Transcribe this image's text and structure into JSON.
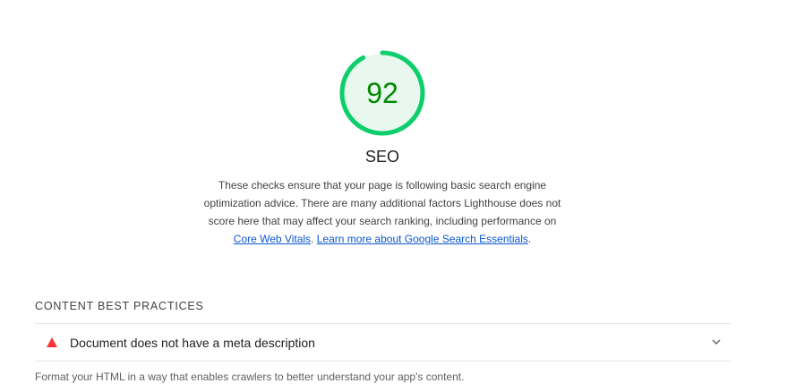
{
  "score": {
    "value": "92",
    "fraction": 0.92,
    "color": "#0cce6b",
    "text_color": "#008800",
    "fill_color": "#e8f8ee"
  },
  "category": {
    "title": "SEO",
    "description_text": "These checks ensure that your page is following basic search engine optimization advice. There are many additional factors Lighthouse does not score here that may affect your search ranking, including performance on",
    "link_core_web_vitals": "Core Web Vitals",
    "separator": ".",
    "link_learn_more": "Learn more about Google Search Essentials",
    "end_period": "."
  },
  "group": {
    "header": "CONTENT BEST PRACTICES",
    "audit": {
      "icon": "fail-triangle-icon",
      "icon_color": "#ff3333",
      "title": "Document does not have a meta description",
      "chevron": "chevron-down-icon"
    },
    "description": "Format your HTML in a way that enables crawlers to better understand your app's content."
  }
}
